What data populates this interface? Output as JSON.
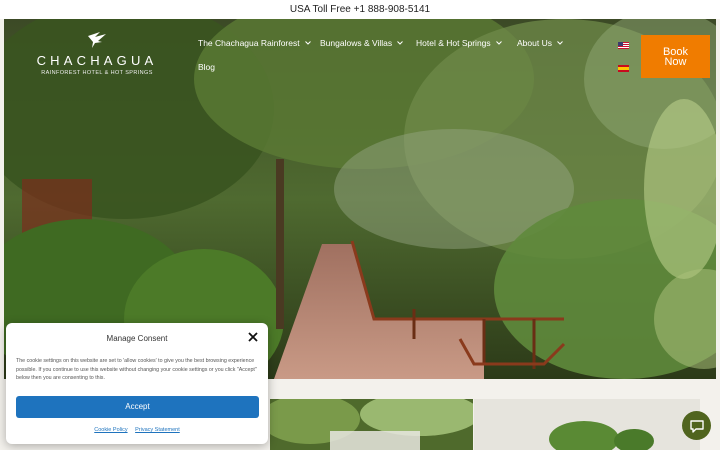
{
  "topbar": {
    "phone_text": "USA Toll Free +1 888-908-5141"
  },
  "brand": {
    "name": "CHACHAGUA",
    "tagline": "RAINFOREST HOTEL & HOT SPRINGS",
    "bird_icon": "hummingbird-logo-icon"
  },
  "nav": {
    "items": [
      {
        "label": "The Chachagua Rainforest",
        "has_dropdown": true
      },
      {
        "label": "Bungalows & Villas",
        "has_dropdown": true
      },
      {
        "label": "Hotel & Hot Springs",
        "has_dropdown": true
      },
      {
        "label": "About Us",
        "has_dropdown": true
      },
      {
        "label": "Blog",
        "has_dropdown": false
      }
    ],
    "languages": [
      "us-flag-icon",
      "es-flag-icon"
    ],
    "book_line1": "Book",
    "book_line2": "Now"
  },
  "consent": {
    "title": "Manage Consent",
    "body": "The cookie settings on this website are set to 'allow cookies' to give you the best browsing experience possible. If you continue to use this website without changing your cookie settings or you click \"Accept\" below then you are consenting to this.",
    "accept_label": "Accept",
    "cookie_policy_label": "Cookie Policy",
    "privacy_label": "Privacy Statement"
  },
  "colors": {
    "accent": "#f07c00",
    "accept_blue": "#1e73be",
    "chat_green": "#50641e"
  }
}
